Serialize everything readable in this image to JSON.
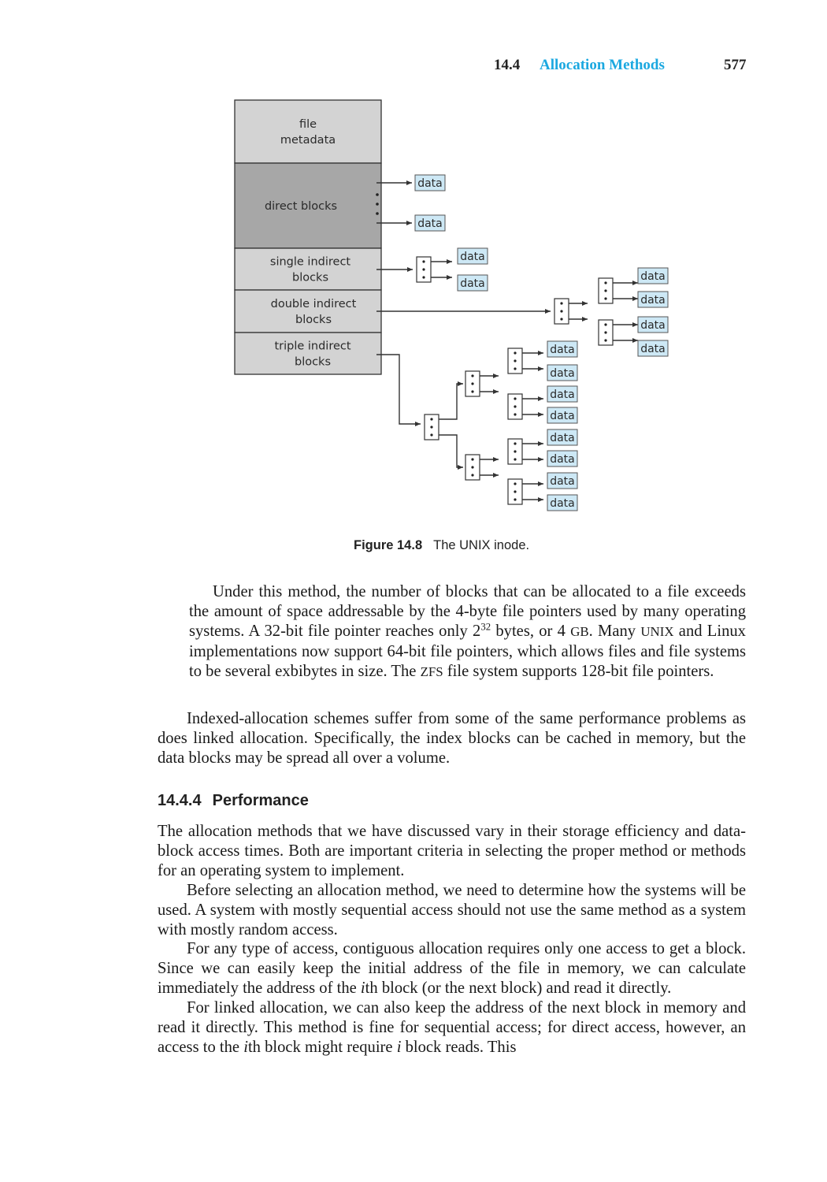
{
  "header": {
    "section_number": "14.4",
    "section_title": "Allocation Methods",
    "page_number": "577"
  },
  "figure": {
    "inode_rows": [
      {
        "id": "file-metadata",
        "lines": [
          "file",
          "metadata"
        ]
      },
      {
        "id": "direct-blocks",
        "lines": [
          "direct blocks"
        ]
      },
      {
        "id": "single-indirect-blocks",
        "lines": [
          "single indirect",
          "blocks"
        ]
      },
      {
        "id": "double-indirect-blocks",
        "lines": [
          "double indirect",
          "blocks"
        ]
      },
      {
        "id": "triple-indirect-blocks",
        "lines": [
          "triple indirect",
          "blocks"
        ]
      }
    ],
    "data_label": "data",
    "colors": {
      "metadata_fill": "#d3d3d3",
      "direct_fill": "#a7a7a7",
      "indirect_fill": "#d3d3d3",
      "data_fill": "#cde8f5",
      "line": "#333333"
    },
    "caption_number": "Figure 14.8",
    "caption_text": "The UNIX inode."
  },
  "body": {
    "p1_a": "Under this method, the number of blocks that can be allocated to a file exceeds the amount of space addressable by the 4-byte file pointers used by many operating systems. A 32-bit file pointer reaches only 2",
    "p1_sup": "32",
    "p1_b": " bytes, or 4 ",
    "p1_gb": "GB",
    "p1_c": ". Many ",
    "p1_unix": "UNIX",
    "p1_d": " and Linux implementations now support 64-bit file pointers, which allows files and file systems to be several exbibytes in size. The ",
    "p1_zfs": "ZFS",
    "p1_e": " file system supports 128-bit file pointers.",
    "p2": "Indexed-allocation schemes suffer from some of the same performance problems as does linked allocation. Specifically, the index blocks can be cached in memory, but the data blocks may be spread all over a volume.",
    "subsection_number": "14.4.4",
    "subsection_title": "Performance",
    "p3": "The allocation methods that we have discussed vary in their storage efficiency and data-block access times. Both are important criteria in selecting the proper method or methods for an operating system to implement.",
    "p4": "Before selecting an allocation method, we need to determine how the systems will be used. A system with mostly sequential access should not use the same method as a system with mostly random access.",
    "p5_a": "For any type of access, contiguous allocation requires only one access to get a block. Since we can easily keep the initial address of the file in memory, we can calculate immediately the address of the ",
    "p5_i": "i",
    "p5_b": "th block (or the next block) and read it directly.",
    "p6_a": "For linked allocation, we can also keep the address of the next block in memory and read it directly. This method is fine for sequential access; for direct access, however, an access to the ",
    "p6_i1": "i",
    "p6_b": "th block might require ",
    "p6_i2": "i",
    "p6_c": " block reads. This"
  }
}
